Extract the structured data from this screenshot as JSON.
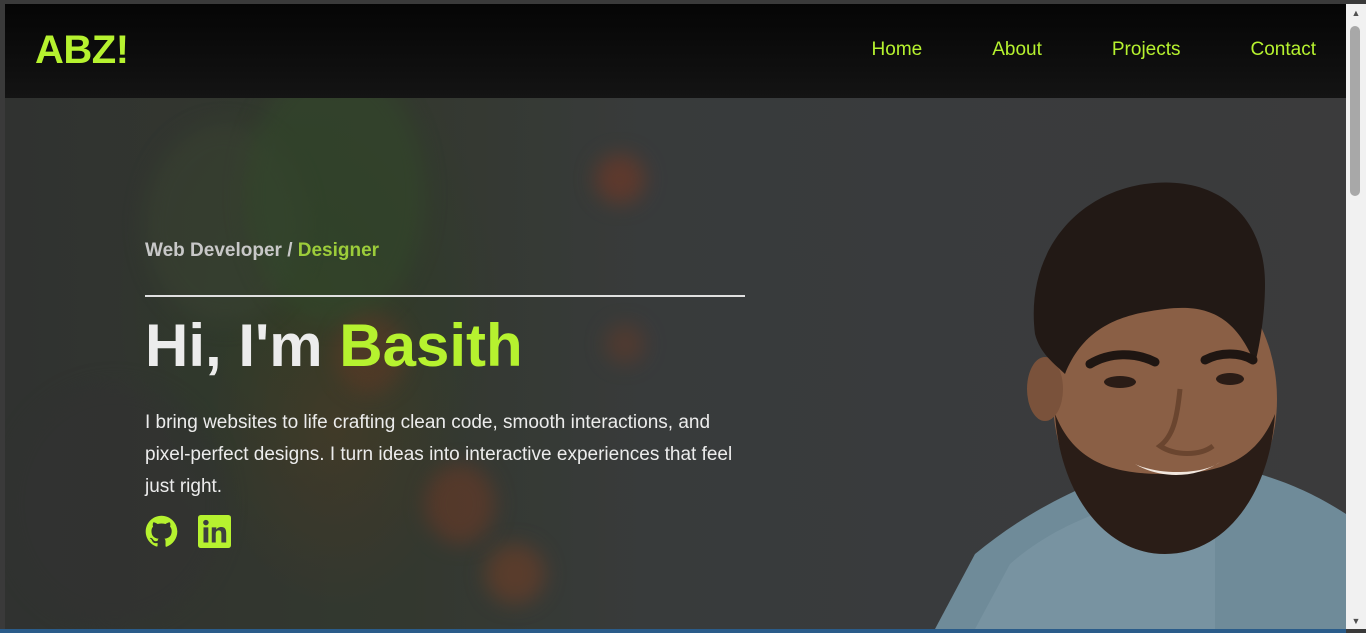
{
  "brand": {
    "logo": "ABZ!"
  },
  "nav": {
    "items": [
      {
        "label": "Home"
      },
      {
        "label": "About"
      },
      {
        "label": "Projects"
      },
      {
        "label": "Contact"
      }
    ]
  },
  "hero": {
    "role_prefix": "Web Developer / ",
    "role_accent": "Designer",
    "greeting_prefix": "Hi, I'm ",
    "greeting_name": "Basith",
    "bio": "I bring websites to life crafting clean code, smooth interactions, and pixel-perfect designs. I turn ideas into interactive experiences that feel just right.",
    "socials": [
      {
        "icon": "github-icon"
      },
      {
        "icon": "linkedin-icon"
      }
    ]
  },
  "colors": {
    "accent": "#b6f22f",
    "nav_bg": "#0a0a0a",
    "text": "#ececec"
  }
}
